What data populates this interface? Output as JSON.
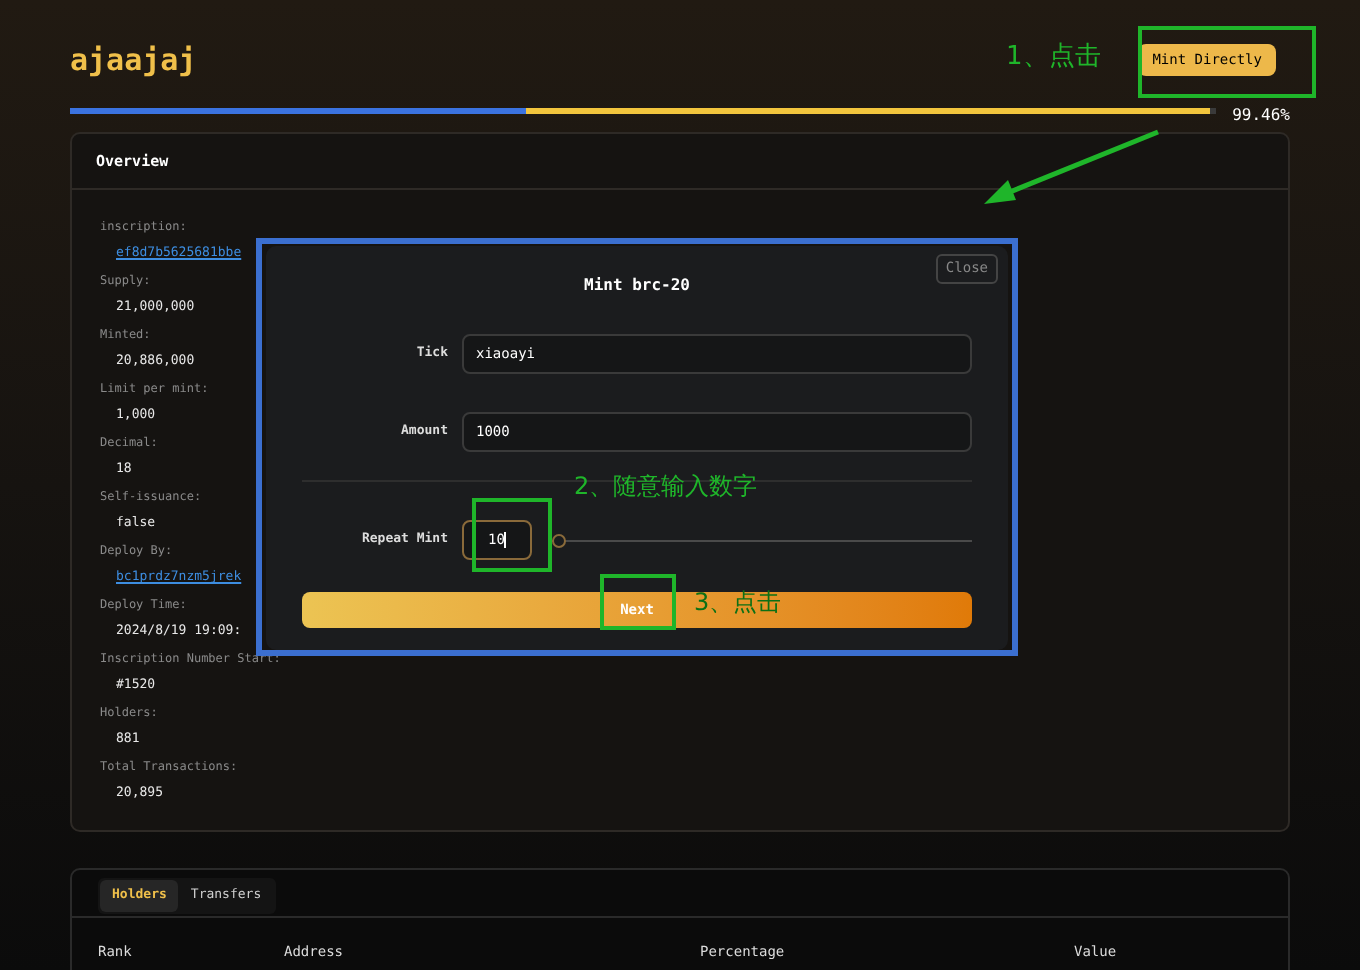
{
  "header": {
    "title": "ajaajaj",
    "button": "Mint Directly",
    "progress": {
      "level": 0.9946,
      "reading": "99.46%"
    }
  },
  "overview": {
    "title": "Overview",
    "fields": [
      {
        "label": "inscription:",
        "value": "ef8d7b5625681bbe",
        "kind": "link"
      },
      {
        "label": "Supply:",
        "value": "21,000,000",
        "kind": "text"
      },
      {
        "label": "Minted:",
        "value": "20,886,000",
        "kind": "text"
      },
      {
        "label": "Limit per mint:",
        "value": "1,000",
        "kind": "text"
      },
      {
        "label": "Decimal:",
        "value": "18",
        "kind": "text"
      },
      {
        "label": "Self-issuance:",
        "value": "false",
        "kind": "text"
      },
      {
        "label": "Deploy By:",
        "value": "bc1prdz7nzm5jrek",
        "kind": "link"
      },
      {
        "label": "Deploy Time:",
        "value": "2024/8/19 19:09:",
        "kind": "text"
      },
      {
        "label": "Inscription Number Start:",
        "value": "#1520",
        "kind": "text"
      },
      {
        "label": "Holders:",
        "value": "881",
        "kind": "text"
      },
      {
        "label": "Total Transactions:",
        "value": "20,895",
        "kind": "text"
      }
    ]
  },
  "modal": {
    "title": "Mint brc-20",
    "close": "Close",
    "fields": [
      {
        "label": "Tick",
        "value": "xiaoayi"
      },
      {
        "label": "Amount",
        "value": "1000"
      }
    ],
    "repeat": {
      "label": "Repeat Mint",
      "value": "10",
      "level": 0
    },
    "button": "Next"
  },
  "tabs": [
    {
      "label": "Holders",
      "selected": true
    },
    {
      "label": "Transfers",
      "selected": false
    }
  ],
  "table": {
    "columns": [
      "Rank",
      "Address",
      "Percentage",
      "Value"
    ]
  },
  "annotations": [
    "1、点击",
    "2、随意输入数字",
    "3、点击"
  ]
}
